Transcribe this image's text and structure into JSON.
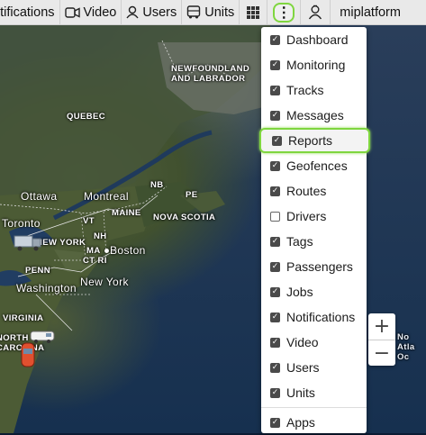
{
  "toolbar": {
    "items": [
      {
        "label": "otifications",
        "icon": "none"
      },
      {
        "label": "Video",
        "icon": "video-icon"
      },
      {
        "label": "Users",
        "icon": "user-icon"
      },
      {
        "label": "Units",
        "icon": "bus-icon"
      }
    ],
    "account_label": "miplatform",
    "more_glyph": "⋮"
  },
  "menu": {
    "items": [
      {
        "label": "Dashboard",
        "checked": true
      },
      {
        "label": "Monitoring",
        "checked": true
      },
      {
        "label": "Tracks",
        "checked": true
      },
      {
        "label": "Messages",
        "checked": true
      },
      {
        "label": "Reports",
        "checked": true,
        "highlighted": true
      },
      {
        "label": "Geofences",
        "checked": true
      },
      {
        "label": "Routes",
        "checked": true
      },
      {
        "label": "Drivers",
        "checked": false
      },
      {
        "label": "Tags",
        "checked": true
      },
      {
        "label": "Passengers",
        "checked": true
      },
      {
        "label": "Jobs",
        "checked": true
      },
      {
        "label": "Notifications",
        "checked": true
      },
      {
        "label": "Video",
        "checked": true
      },
      {
        "label": "Users",
        "checked": true
      },
      {
        "label": "Units",
        "checked": true
      }
    ],
    "footer": {
      "label": "Apps",
      "checked": true
    }
  },
  "map": {
    "labels": {
      "newfoundland": "NEWFOUNDLAND\nAND LABRADOR",
      "quebec": "QUEBEC",
      "ottawa": "Ottawa",
      "montreal": "Montreal",
      "nb": "NB",
      "pe": "PE",
      "toronto": "Toronto",
      "vt": "VT",
      "maine": "MAINE",
      "nova_scotia": "NOVA SCOTIA",
      "new_york": "NEW YORK",
      "nh": "NH",
      "ma": "MA",
      "boston": "Boston",
      "ct_ri": "CT RI",
      "penn": "PENN",
      "washington": "Washington",
      "new_york_city": "New York",
      "virginia": "VIRGINIA",
      "north_carolina": "NORTH\nCAROLINA",
      "atlantic": "No\nAtla\nOc"
    },
    "zoom_in": "+",
    "zoom_out": "−"
  },
  "colors": {
    "highlight": "#7fd63f",
    "checkbox": "#4a4a4a"
  }
}
